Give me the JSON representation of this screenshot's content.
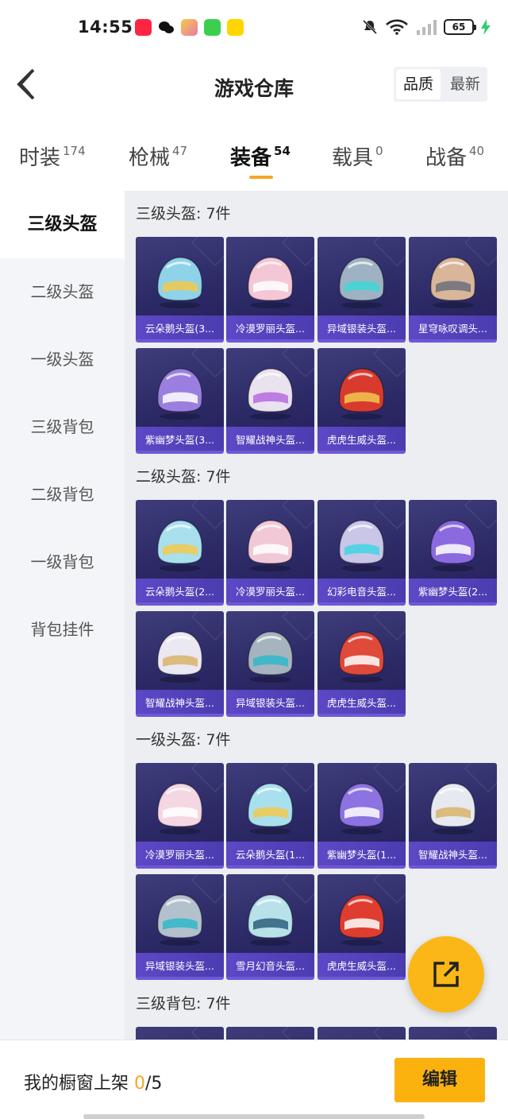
{
  "status_bar": {
    "time": "14:55",
    "battery": "65",
    "icons": [
      "xiaohongshu-icon",
      "wechat-icon",
      "game-app-icon",
      "messages-icon",
      "mall-app-icon",
      "mute-icon",
      "wifi-icon",
      "signal-icon",
      "battery-icon",
      "charging-icon"
    ]
  },
  "header": {
    "title": "游戏仓库",
    "sort_quality": "品质",
    "sort_newest": "最新"
  },
  "tabs": [
    {
      "label": "时装",
      "count": "174"
    },
    {
      "label": "枪械",
      "count": "47"
    },
    {
      "label": "装备",
      "count": "54"
    },
    {
      "label": "载具",
      "count": "0"
    },
    {
      "label": "战备",
      "count": "40"
    }
  ],
  "sidebar": {
    "items": [
      "三级头盔",
      "二级头盔",
      "一级头盔",
      "三级背包",
      "二级背包",
      "一级背包",
      "背包挂件"
    ],
    "active": "三级头盔"
  },
  "sections": [
    {
      "title": "三级头盔: 7件",
      "items": [
        {
          "name": "云朵鹅头盔(3...",
          "color": "#8fd3e8",
          "accent": "#f2c94c"
        },
        {
          "name": "冷漠罗丽头盔...",
          "color": "#f3c7d6",
          "accent": "#ffffff"
        },
        {
          "name": "异域银装头盔...",
          "color": "#9fb2c3",
          "accent": "#3fd6d6"
        },
        {
          "name": "星穹咏叹调头...",
          "color": "#d9b59a",
          "accent": "#6b6f7c"
        },
        {
          "name": "紫幽梦头盔(3...",
          "color": "#9a7fe0",
          "accent": "#ffffff"
        },
        {
          "name": "智耀战神头盔...",
          "color": "#e9e2ef",
          "accent": "#b66be0"
        },
        {
          "name": "虎虎生威头盔...",
          "color": "#d83b2e",
          "accent": "#f2c94c"
        }
      ]
    },
    {
      "title": "二级头盔: 7件",
      "items": [
        {
          "name": "云朵鹅头盔(2...",
          "color": "#a9e0ee",
          "accent": "#f2c94c"
        },
        {
          "name": "冷漠罗丽头盔...",
          "color": "#f1c9d6",
          "accent": "#ffffff"
        },
        {
          "name": "幻彩电音头盔...",
          "color": "#c9c6e8",
          "accent": "#3fd6e0"
        },
        {
          "name": "紫幽梦头盔(2...",
          "color": "#8b6ae0",
          "accent": "#ffffff"
        },
        {
          "name": "智耀战神头盔...",
          "color": "#ece8f2",
          "accent": "#d9b36b"
        },
        {
          "name": "异域银装头盔...",
          "color": "#a6b4c0",
          "accent": "#2fb8c8"
        },
        {
          "name": "虎虎生威头盔...",
          "color": "#e04a3a",
          "accent": "#ffffff"
        }
      ]
    },
    {
      "title": "一级头盔: 7件",
      "items": [
        {
          "name": "冷漠罗丽头盔...",
          "color": "#f4d7e2",
          "accent": "#ffffff"
        },
        {
          "name": "云朵鹅头盔(1...",
          "color": "#a9e0ee",
          "accent": "#f2c94c"
        },
        {
          "name": "紫幽梦头盔(1...",
          "color": "#8d72e2",
          "accent": "#ffffff"
        },
        {
          "name": "智耀战神头盔...",
          "color": "#e7e9f0",
          "accent": "#d9b36b"
        },
        {
          "name": "异域银装头盔...",
          "color": "#b3c1cc",
          "accent": "#2fb8c8"
        },
        {
          "name": "雪月幻音头盔...",
          "color": "#b8e1ea",
          "accent": "#2b5f7c"
        },
        {
          "name": "虎虎生威头盔...",
          "color": "#de3d2f",
          "accent": "#ffffff"
        }
      ]
    },
    {
      "title": "三级背包: 7件",
      "items": [
        {
          "name": "",
          "color": "#8fd3e8",
          "accent": "#ffffff"
        },
        {
          "name": "",
          "color": "#f3c7d6",
          "accent": "#ffffff"
        },
        {
          "name": "",
          "color": "#9fb2c3",
          "accent": "#ffffff"
        },
        {
          "name": "",
          "color": "#d9b59a",
          "accent": "#ffffff"
        }
      ]
    }
  ],
  "bottom_bar": {
    "showcase_label": "我的橱窗上架",
    "showcase_count": "0",
    "showcase_total": "/5",
    "edit_label": "编辑"
  },
  "colors": {
    "accent": "#f5a623",
    "button": "#fbb20f",
    "card_bg": "#2c2a66",
    "card_label_bg": "#5d48c6"
  }
}
